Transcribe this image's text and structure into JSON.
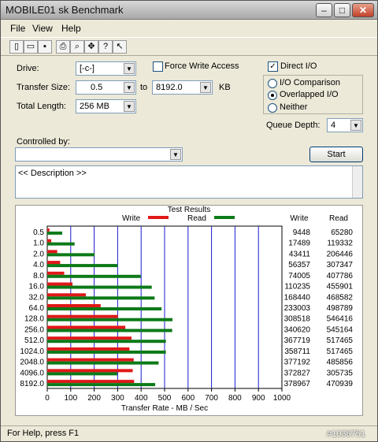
{
  "window": {
    "title": "MOBILE01 sk Benchmark"
  },
  "menu": [
    "File",
    "View",
    "Help"
  ],
  "toolbar": {
    "icons": [
      "new-icon",
      "open-icon",
      "save-icon",
      "print-icon",
      "print-preview-icon",
      "move-icon",
      "help-icon",
      "context-help-icon"
    ]
  },
  "form": {
    "drive_label": "Drive:",
    "drive_value": "[-c-]",
    "force_write_label": "Force Write Access",
    "force_write_checked": false,
    "transfer_label": "Transfer Size:",
    "transfer_from": "0.5",
    "to_label": "to",
    "transfer_to": "8192.0",
    "kb_label": "KB",
    "total_label": "Total Length:",
    "total_value": "256 MB",
    "direct_io_label": "Direct I/O",
    "direct_io_checked": true,
    "radios": [
      "I/O Comparison",
      "Overlapped I/O",
      "Neither"
    ],
    "selected_radio": "Overlapped I/O",
    "queue_label": "Queue Depth:",
    "queue_value": "4",
    "controlled_label": "Controlled by:",
    "controlled_value": "",
    "start_label": "Start",
    "description": "<< Description >>"
  },
  "chart_data": {
    "type": "bar",
    "title": "Test Results",
    "xlabel": "Transfer Rate - MB / Sec",
    "xlim": [
      0,
      1000
    ],
    "xticks": [
      0,
      100,
      200,
      300,
      400,
      500,
      600,
      700,
      800,
      900,
      1000
    ],
    "legend": [
      "Write",
      "Read"
    ],
    "colors": {
      "Write": "#e01818",
      "Read": "#0c7a18"
    },
    "columns": [
      "Write",
      "Read"
    ],
    "categories": [
      "0.5",
      "1.0",
      "2.0",
      "4.0",
      "8.0",
      "16.0",
      "32.0",
      "64.0",
      "128.0",
      "256.0",
      "512.0",
      "1024.0",
      "2048.0",
      "4096.0",
      "8192.0"
    ],
    "series": [
      {
        "name": "Write",
        "values": [
          9448,
          17489,
          43411,
          56357,
          74005,
          110235,
          168440,
          233003,
          308518,
          340620,
          367719,
          358711,
          377192,
          372827,
          378967
        ]
      },
      {
        "name": "Read",
        "values": [
          65280,
          119332,
          206446,
          307347,
          407786,
          455901,
          468582,
          498789,
          546416,
          545164,
          517465,
          517465,
          485856,
          305735,
          470939
        ]
      }
    ]
  },
  "status": {
    "text": "For Help, press F1",
    "watermark": "#1036751"
  }
}
